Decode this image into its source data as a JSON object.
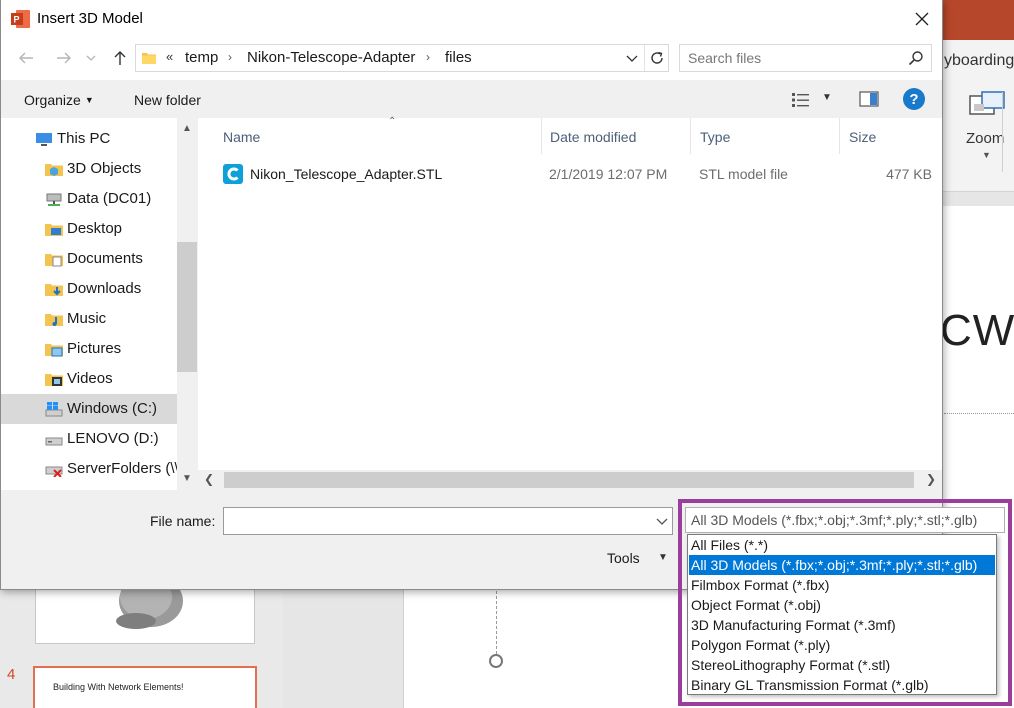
{
  "dialog": {
    "title": "Insert 3D Model",
    "close_glyph": "✕"
  },
  "navigation": {
    "overflow": "«",
    "breadcrumbs": [
      "temp",
      "Nikon-Telescope-Adapter",
      "files"
    ]
  },
  "search": {
    "placeholder": "Search files"
  },
  "toolbar": {
    "organize_label": "Organize",
    "new_folder_label": "New folder",
    "help_glyph": "?"
  },
  "sidebar": {
    "items": [
      {
        "label": "This PC",
        "icon": "pc-icon"
      },
      {
        "label": "3D Objects",
        "icon": "folder-3d-icon"
      },
      {
        "label": "Data (DC01)",
        "icon": "network-drive-icon"
      },
      {
        "label": "Desktop",
        "icon": "desktop-folder-icon"
      },
      {
        "label": "Documents",
        "icon": "documents-folder-icon"
      },
      {
        "label": "Downloads",
        "icon": "downloads-folder-icon"
      },
      {
        "label": "Music",
        "icon": "music-folder-icon"
      },
      {
        "label": "Pictures",
        "icon": "pictures-folder-icon"
      },
      {
        "label": "Videos",
        "icon": "videos-folder-icon"
      },
      {
        "label": "Windows (C:)",
        "icon": "windows-drive-icon"
      },
      {
        "label": "LENOVO (D:)",
        "icon": "drive-icon"
      },
      {
        "label": "ServerFolders (\\\\",
        "icon": "disconnected-drive-icon"
      }
    ],
    "selected_index": 9
  },
  "file_list": {
    "columns": [
      "Name",
      "Date modified",
      "Type",
      "Size"
    ],
    "rows": [
      {
        "name": "Nikon_Telescope_Adapter.STL",
        "date_modified": "2/1/2019 12:07 PM",
        "type": "STL model file",
        "size": "477 KB"
      }
    ]
  },
  "bottom": {
    "file_name_label": "File name:",
    "file_name_value": "",
    "tools_label": "Tools",
    "filter_selected": "All 3D Models (*.fbx;*.obj;*.3mf;*.ply;*.stl;*.glb)",
    "filter_options": [
      "All Files (*.*)",
      "All 3D Models (*.fbx;*.obj;*.3mf;*.ply;*.stl;*.glb)",
      "Filmbox Format (*.fbx)",
      "Object Format (*.obj)",
      "3D Manufacturing Format (*.3mf)",
      "Polygon Format (*.ply)",
      "StereoLithography Format (*.stl)",
      "Binary GL Transmission Format (*.glb)"
    ],
    "filter_selected_index": 1
  },
  "powerpoint": {
    "ribbon_tab_partial": "yboarding",
    "zoom_label": "Zoom",
    "slide_number": "4",
    "slide_thumb_title": "Building With Network Elements!",
    "slide_text_partial": "CWC"
  },
  "colors": {
    "accent_selection": "#0078d7",
    "highlight_border": "#9b3d9b",
    "ppt_brand": "#b7472a",
    "help_icon": "#1979ca"
  }
}
